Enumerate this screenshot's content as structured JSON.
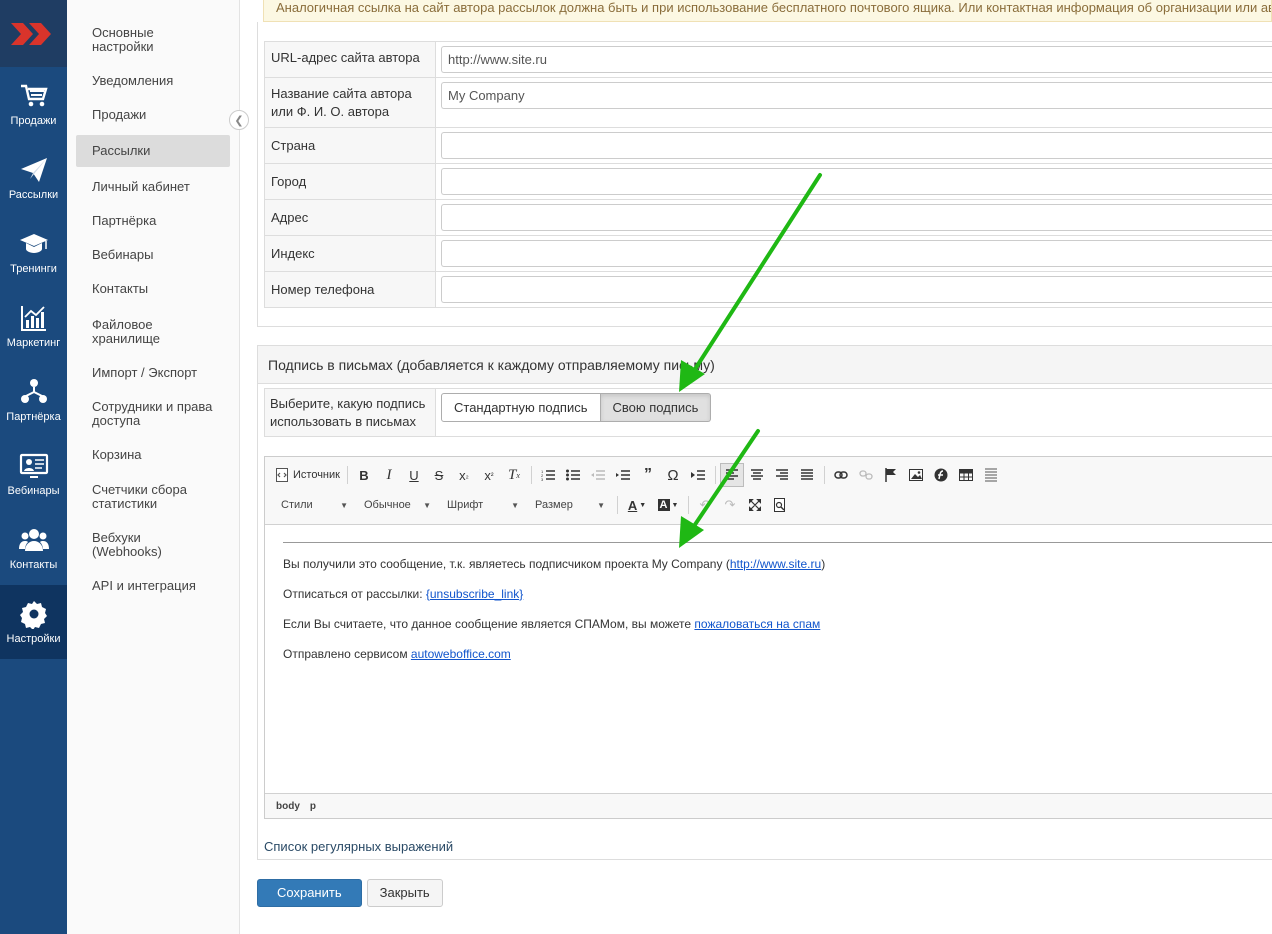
{
  "notice_text": "Аналогичная ссылка на сайт автора рассылок должна быть и при использование бесплатного почтового ящика. Или контактная информация об организации или авторе, е",
  "rail": [
    {
      "label": "Продажи",
      "icon": "cart-icon"
    },
    {
      "label": "Рассылки",
      "icon": "paper-plane-icon"
    },
    {
      "label": "Тренинги",
      "icon": "graduation-cap-icon"
    },
    {
      "label": "Маркетинг",
      "icon": "chart-icon"
    },
    {
      "label": "Партнёрка",
      "icon": "network-icon"
    },
    {
      "label": "Вебинары",
      "icon": "monitor-icon"
    },
    {
      "label": "Контакты",
      "icon": "users-icon"
    },
    {
      "label": "Настройки",
      "icon": "gear-icon",
      "active": true
    }
  ],
  "subnav": [
    "Основные настройки",
    "Уведомления",
    "Продажи",
    "Рассылки",
    "Личный кабинет",
    "Партнёрка",
    "Вебинары",
    "Контакты",
    "Файловое хранилище",
    "Импорт / Экспорт",
    "Сотрудники и права доступа",
    "Корзина",
    "Счетчики сбора статистики",
    "Вебхуки (Webhooks)",
    "API и интеграция"
  ],
  "subnav_active": "Рассылки",
  "form": {
    "rows": [
      {
        "label": "URL-адрес сайта автора",
        "value": "http://www.site.ru"
      },
      {
        "label": "Название сайта автора или Ф. И. О. автора",
        "value": "My Company"
      },
      {
        "label": "Страна",
        "value": ""
      },
      {
        "label": "Город",
        "value": ""
      },
      {
        "label": "Адрес",
        "value": ""
      },
      {
        "label": "Индекс",
        "value": ""
      },
      {
        "label": "Номер телефона",
        "value": ""
      }
    ]
  },
  "signature": {
    "heading": "Подпись в письмах (добавляется к каждому отправляемому письму)",
    "choose_label": "Выберите, какую подпись использовать в письмах",
    "option_standard": "Стандартную подпись",
    "option_custom": "Свою подпись",
    "selected": "Свою подпись"
  },
  "editor": {
    "source_label": "Источник",
    "combo_styles": "Стили",
    "combo_format": "Обычное",
    "combo_font": "Шрифт",
    "combo_size": "Размер",
    "lines": {
      "l1_text": "Вы получили это сообщение, т.к. являетесь подписчиком проекта My Company (",
      "l1_link": "http://www.site.ru",
      "l1_end": ")",
      "l2_text": "Отписаться от рассылки: ",
      "l2_link": "{unsubscribe_link}",
      "l3_text": "Если Вы считаете, что данное сообщение является СПАМом, вы можете ",
      "l3_link": "пожаловаться на спам",
      "l4_text": "Отправлено сервисом ",
      "l4_link": "autowebofficе.com"
    },
    "path": [
      "body",
      "p"
    ]
  },
  "regex_link": "Список регулярных выражений",
  "actions": {
    "save": "Сохранить",
    "close": "Закрыть"
  },
  "colors": {
    "rail": "#1b4a7e",
    "primary": "#337ab7",
    "arrow": "#1fb814"
  }
}
